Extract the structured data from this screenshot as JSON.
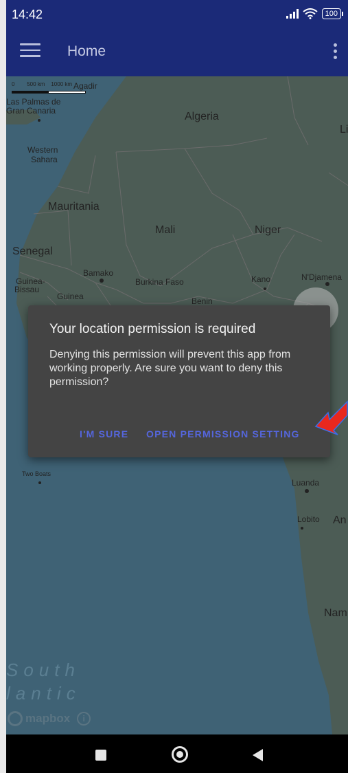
{
  "status_bar": {
    "time": "14:42",
    "battery": "100"
  },
  "app_bar": {
    "title": "Home"
  },
  "map": {
    "scale": {
      "label_0": "0",
      "label_500": "500 km",
      "label_1000": "1000 km"
    },
    "labels": {
      "agadir": "Agadir",
      "las_palmas_1": "Las Palmas de",
      "las_palmas_2": "Gran Canaria",
      "algeria": "Algeria",
      "libya_partial": "Li",
      "western_sahara_1": "Western",
      "western_sahara_2": "Sahara",
      "mauritania": "Mauritania",
      "mali": "Mali",
      "niger": "Niger",
      "senegal": "Senegal",
      "bamako": "Bamako",
      "guinea_bissau_1": "Guinea-",
      "guinea_bissau_2": "Bissau",
      "guinea": "Guinea",
      "burkina_faso": "Burkina Faso",
      "benin": "Benin",
      "kano": "Kano",
      "ndjamena": "N'Djamena",
      "two_boats": "Two Boats",
      "luanda": "Luanda",
      "lobito": "Lobito",
      "angola_partial": "An",
      "namibia_partial": "Nam",
      "ocean_1": "South",
      "ocean_2": "lantic"
    },
    "attribution": "mapbox",
    "info_glyph": "i"
  },
  "dialog": {
    "title": "Your location permission is required",
    "message": "Denying this permission will prevent this app from working properly. Are sure you want to deny this permission?",
    "negative_button": "I'M SURE",
    "positive_button": "OPEN PERMISSION SETTING"
  },
  "fab": {
    "icon": "mail-icon"
  },
  "nav_bar": {
    "recents": "recents-icon",
    "home": "home-icon",
    "back": "back-icon"
  },
  "colors": {
    "app_bar": "#1b2a78",
    "dialog_bg": "#444444",
    "dialog_button": "#5566dd",
    "fab": "#0c5b51",
    "arrow": "#e8281e"
  }
}
